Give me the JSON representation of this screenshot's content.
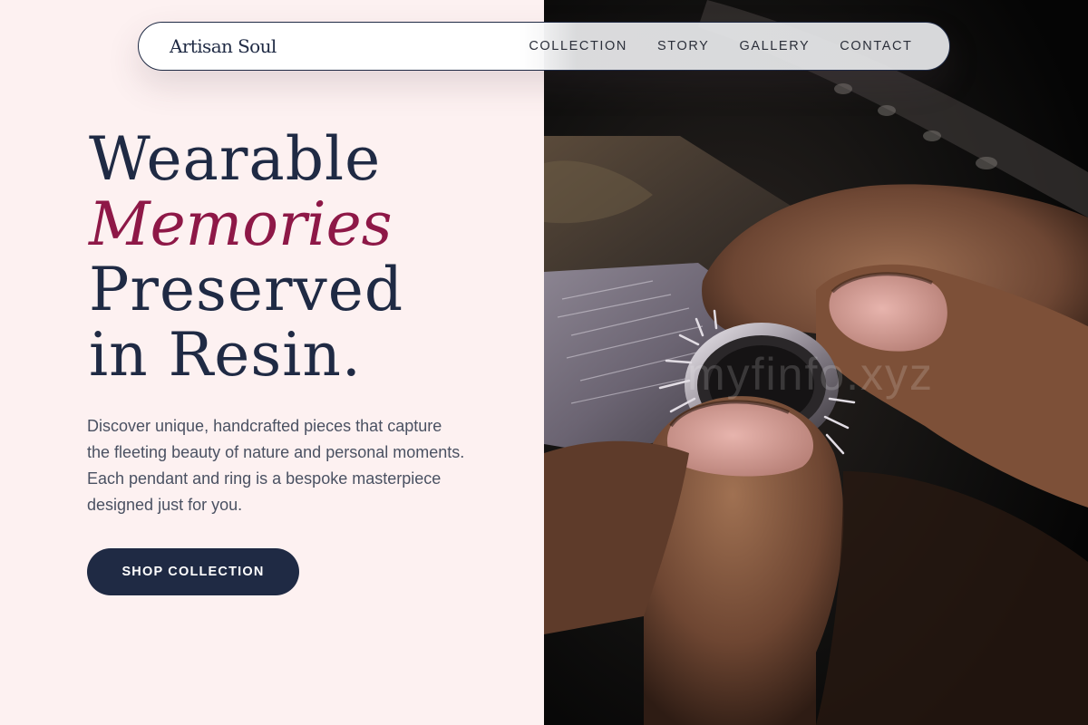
{
  "brand": {
    "name": "Artisan Soul"
  },
  "nav": {
    "items": [
      {
        "label": "COLLECTION"
      },
      {
        "label": "STORY"
      },
      {
        "label": "GALLERY"
      },
      {
        "label": "CONTACT"
      }
    ]
  },
  "hero": {
    "headline": {
      "line1": "Wearable",
      "line2": "Memories",
      "line3": "Preserved",
      "line4": "in Resin."
    },
    "description": "Discover unique, handcrafted pieces that capture the fleeting beauty of nature and personal moments. Each pendant and ring is a bespoke masterpiece designed just for you.",
    "cta_label": "SHOP COLLECTION"
  },
  "watermark": "myfinfo.xyz",
  "colors": {
    "background": "#fdf1f1",
    "primary": "#1f2a44",
    "accent": "#8e1847",
    "body_text": "#4a5162"
  }
}
